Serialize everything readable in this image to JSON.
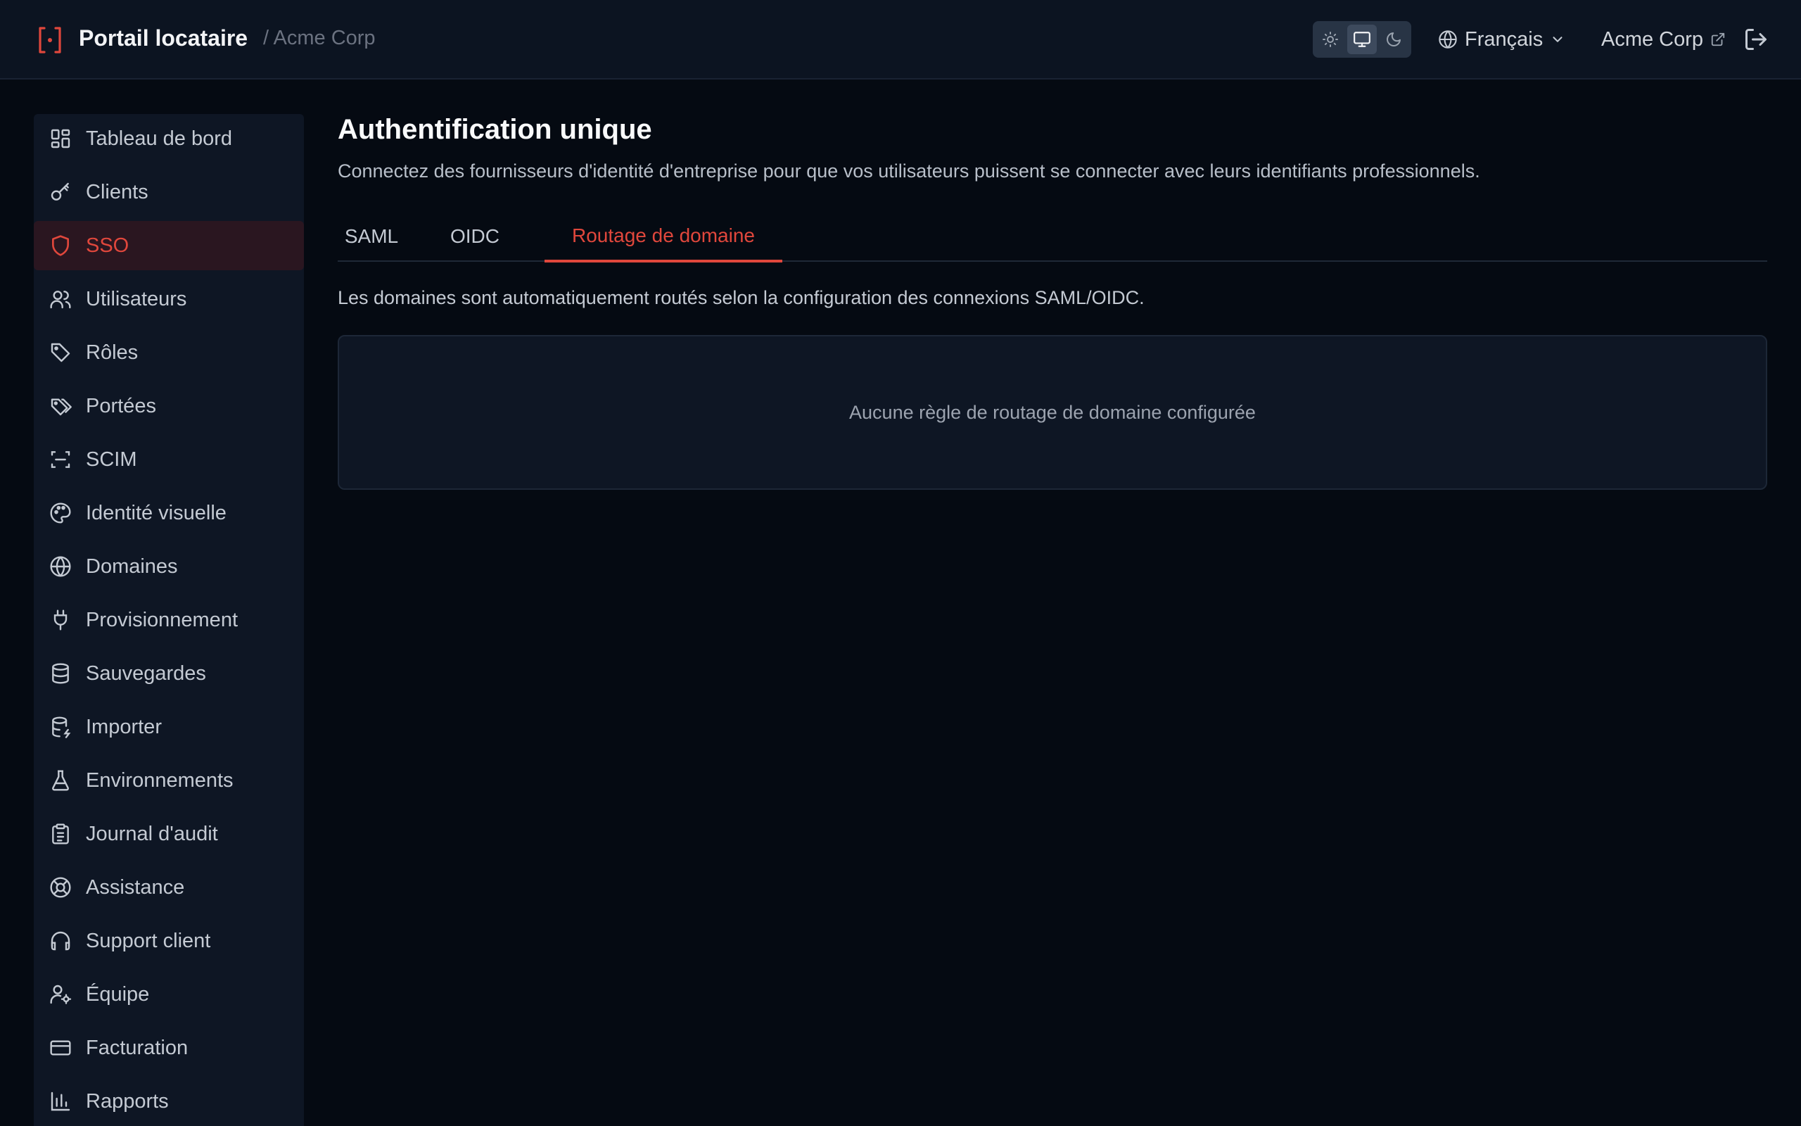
{
  "header": {
    "app_title": "Portail locataire",
    "breadcrumb": "/ Acme Corp",
    "theme_options": [
      "sun-icon",
      "monitor-icon",
      "moon-icon"
    ],
    "language": "Français",
    "organization": "Acme Corp",
    "accent_color": "#e0473c"
  },
  "sidebar": {
    "items": [
      {
        "label": "Tableau de bord",
        "icon": "dashboard-icon"
      },
      {
        "label": "Clients",
        "icon": "key-icon"
      },
      {
        "label": "SSO",
        "icon": "shield-icon",
        "active": true
      },
      {
        "label": "Utilisateurs",
        "icon": "users-icon"
      },
      {
        "label": "Rôles",
        "icon": "tag-icon"
      },
      {
        "label": "Portées",
        "icon": "tags-icon"
      },
      {
        "label": "SCIM",
        "icon": "scan-icon"
      },
      {
        "label": "Identité visuelle",
        "icon": "palette-icon"
      },
      {
        "label": "Domaines",
        "icon": "globe-icon"
      },
      {
        "label": "Provisionnement",
        "icon": "plug-icon"
      },
      {
        "label": "Sauvegardes",
        "icon": "database-icon"
      },
      {
        "label": "Importer",
        "icon": "database-import-icon"
      },
      {
        "label": "Environnements",
        "icon": "flask-icon"
      },
      {
        "label": "Journal d'audit",
        "icon": "clipboard-icon"
      },
      {
        "label": "Assistance",
        "icon": "lifebuoy-icon"
      },
      {
        "label": "Support client",
        "icon": "headphones-icon"
      },
      {
        "label": "Équipe",
        "icon": "user-cog-icon"
      },
      {
        "label": "Facturation",
        "icon": "credit-card-icon"
      },
      {
        "label": "Rapports",
        "icon": "bar-chart-icon"
      }
    ]
  },
  "main": {
    "title": "Authentification unique",
    "subtitle": "Connectez des fournisseurs d'identité d'entreprise pour que vos utilisateurs puissent se connecter avec leurs identifiants professionnels.",
    "tabs": [
      {
        "label": "SAML"
      },
      {
        "label": "OIDC"
      },
      {
        "label": "Routage de domaine",
        "active": true
      }
    ],
    "info": "Les domaines sont automatiquement routés selon la configuration des connexions SAML/OIDC.",
    "empty_state": "Aucune règle de routage de domaine configurée"
  }
}
